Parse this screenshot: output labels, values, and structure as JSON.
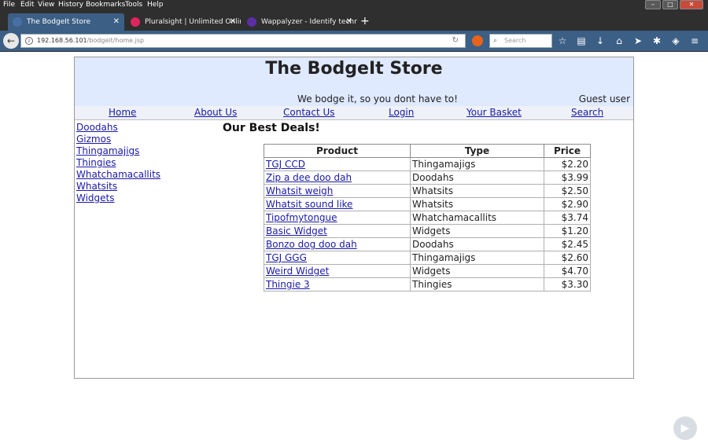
{
  "browser": {
    "menu": [
      "File",
      "Edit",
      "History",
      "Bookmarks",
      "Tools",
      "Help"
    ],
    "tabs": [
      {
        "title": "The BodgeIt Store",
        "active": true,
        "favicon_color": "#4a6fa5"
      },
      {
        "title": "Pluralsight | Unlimited Onlin",
        "active": false,
        "favicon_color": "#e0245e"
      },
      {
        "title": "Wappalyzer - Identify techno",
        "active": false,
        "favicon_color": "#5b2ea6"
      }
    ],
    "new_tab": "+",
    "url_host": "192.168.56.101",
    "url_path": "/bodgeit/home.jsp",
    "search_placeholder": "Search"
  },
  "store": {
    "title": "The BodgeIt Store",
    "tagline": "We bodge it, so you dont have to!",
    "user": "Guest user",
    "nav": [
      "Home",
      "About Us",
      "Contact Us",
      "Login",
      "Your Basket",
      "Search"
    ],
    "categories": [
      "Doodahs",
      "Gizmos",
      "Thingamajigs",
      "Thingies",
      "Whatchamacallits",
      "Whatsits",
      "Widgets"
    ],
    "deals_title": "Our Best Deals!",
    "table": {
      "headers": [
        "Product",
        "Type",
        "Price"
      ],
      "rows": [
        [
          "TGJ CCD",
          "Thingamajigs",
          "$2.20"
        ],
        [
          "Zip a dee doo dah",
          "Doodahs",
          "$3.99"
        ],
        [
          "Whatsit weigh",
          "Whatsits",
          "$2.50"
        ],
        [
          "Whatsit sound like",
          "Whatsits",
          "$2.90"
        ],
        [
          "Tipofmytongue",
          "Whatchamacallits",
          "$3.74"
        ],
        [
          "Basic Widget",
          "Widgets",
          "$1.20"
        ],
        [
          "Bonzo dog doo dah",
          "Doodahs",
          "$2.45"
        ],
        [
          "TGJ GGG",
          "Thingamajigs",
          "$2.60"
        ],
        [
          "Weird Widget",
          "Widgets",
          "$4.70"
        ],
        [
          "Thingie 3",
          "Thingies",
          "$3.30"
        ]
      ]
    }
  },
  "colors": {
    "header_bg": "#dfe9ff",
    "link": "#1a1aa6",
    "chrome": "#3c5f85"
  }
}
